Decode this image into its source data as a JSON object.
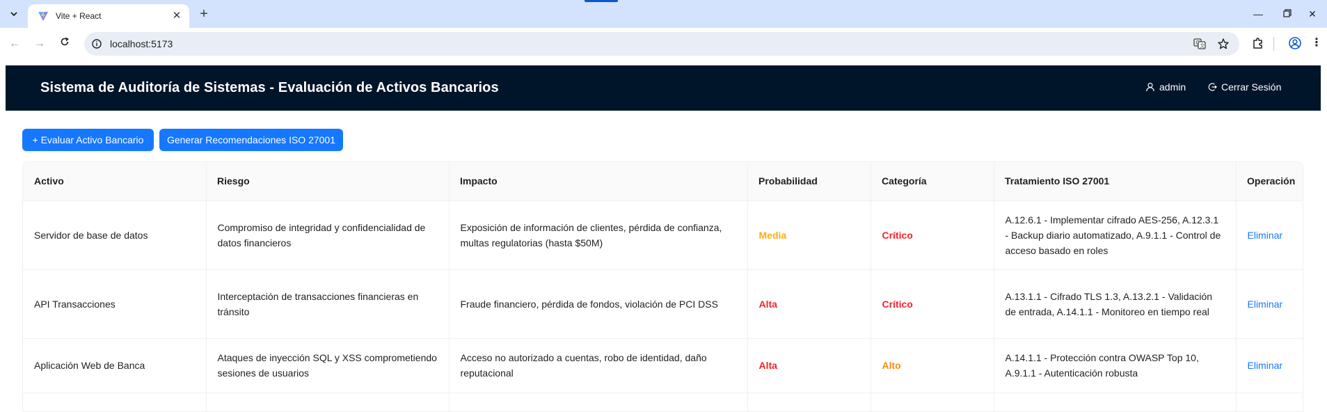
{
  "browser": {
    "tab_title": "Vite + React",
    "url": "localhost:5173",
    "favicon": "vite-icon"
  },
  "header": {
    "title": "Sistema de Auditoría de Sistemas - Evaluación de Activos Bancarios",
    "user_label": "admin",
    "logout_label": "Cerrar Sesión",
    "background": "#001529"
  },
  "actions": {
    "evaluate_label": "+ Evaluar Activo Bancario",
    "recommend_label": "Generar Recomendaciones ISO 27001",
    "primary_color": "#1677ff"
  },
  "table": {
    "columns": [
      "Activo",
      "Riesgo",
      "Impacto",
      "Probabilidad",
      "Categoría",
      "Tratamiento ISO 27001",
      "Operación"
    ],
    "rows": [
      {
        "activo": "Servidor de base de datos",
        "riesgo": "Compromiso de integridad y confidencialidad de datos financieros",
        "impacto": "Exposición de información de clientes, pérdida de confianza, multas regulatorias (hasta $50M)",
        "probabilidad": "Media",
        "categoria": "Crítico",
        "tratamiento": "A.12.6.1 - Implementar cifrado AES-256, A.12.3.1 - Backup diario automatizado, A.9.1.1 - Control de acceso basado en roles",
        "operacion": "Eliminar"
      },
      {
        "activo": "API Transacciones",
        "riesgo": "Interceptación de transacciones financieras en tránsito",
        "impacto": "Fraude financiero, pérdida de fondos, violación de PCI DSS",
        "probabilidad": "Alta",
        "categoria": "Crítico",
        "tratamiento": "A.13.1.1 - Cifrado TLS 1.3, A.13.2.1 - Validación de entrada, A.14.1.1 - Monitoreo en tiempo real",
        "operacion": "Eliminar"
      },
      {
        "activo": "Aplicación Web de Banca",
        "riesgo": "Ataques de inyección SQL y XSS comprometiendo sesiones de usuarios",
        "impacto": "Acceso no autorizado a cuentas, robo de identidad, daño reputacional",
        "probabilidad": "Alta",
        "categoria": "Alto",
        "tratamiento": "A.14.1.1 - Protección contra OWASP Top 10, A.9.1.1 - Autenticación robusta",
        "operacion": "Eliminar"
      }
    ]
  },
  "colors": {
    "media": "#faad14",
    "alta": "#f5222d",
    "critico": "#f5222d",
    "alto": "#fa8c16"
  }
}
